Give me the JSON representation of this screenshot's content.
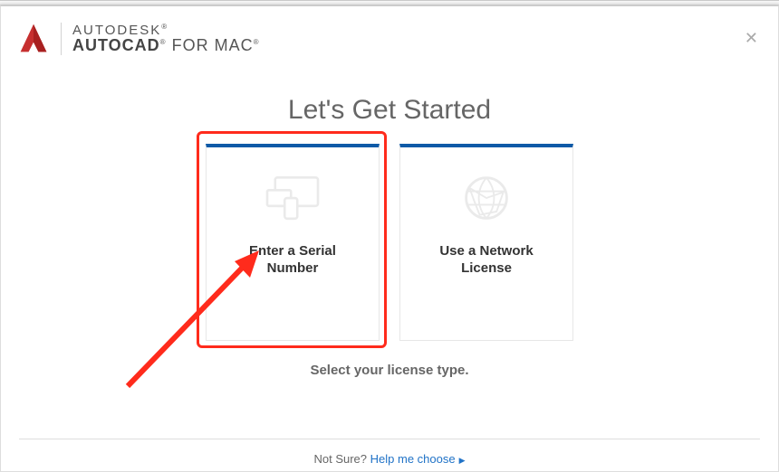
{
  "header": {
    "company": "AUTODESK",
    "product": "AUTOCAD",
    "variant": "FOR MAC"
  },
  "title": "Let's Get Started",
  "cards": [
    {
      "label": "Enter a Serial Number",
      "icon": "devices-icon"
    },
    {
      "label": "Use a Network License",
      "icon": "globe-icon"
    }
  ],
  "subtitle": "Select your license type.",
  "footer": {
    "prompt": "Not Sure? ",
    "link": "Help me choose"
  },
  "colors": {
    "accent": "#0e5aa7",
    "annotation": "#ff2b1c",
    "brand_red": "#c62f2f"
  }
}
